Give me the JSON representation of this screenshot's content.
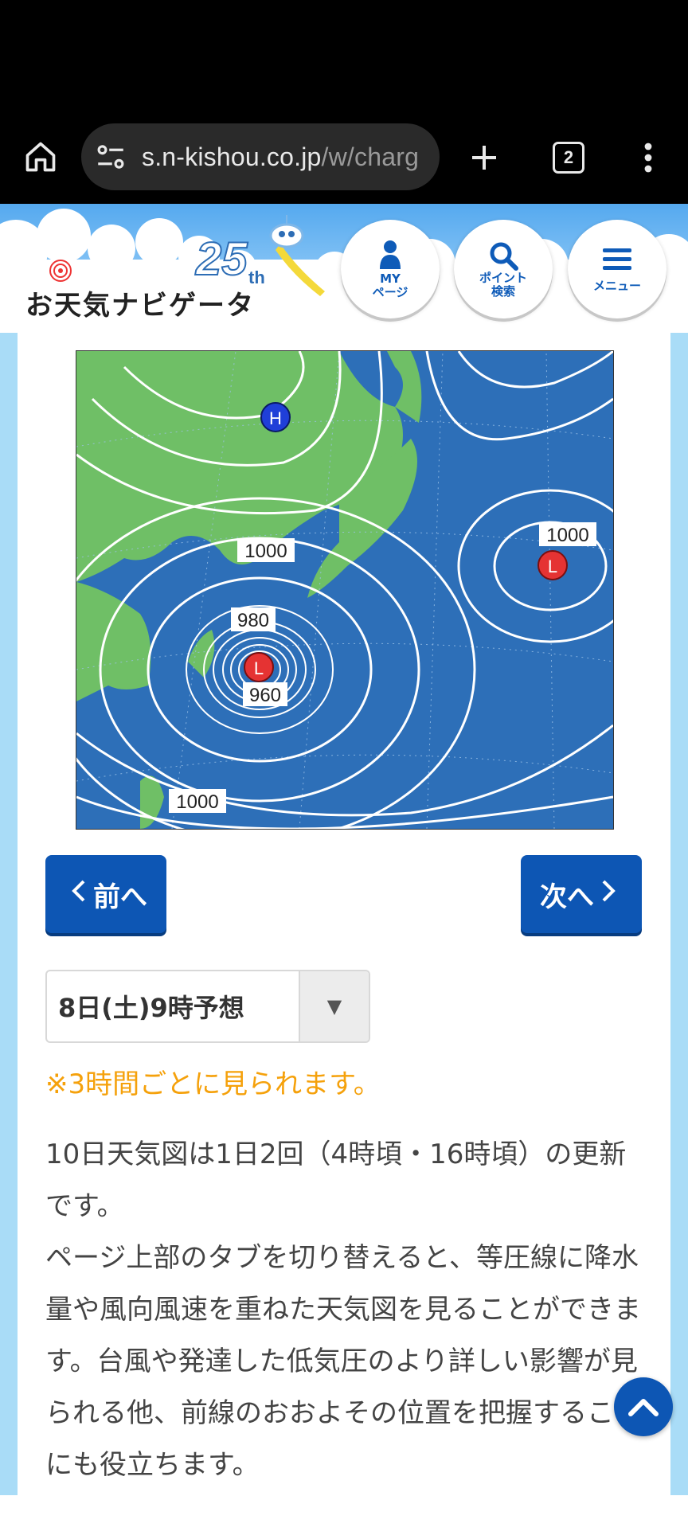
{
  "browser": {
    "url_host": "s.n-kishou.co.jp",
    "url_path": "/w/charg",
    "tab_count": "2"
  },
  "header": {
    "logo_text": "お天気ナビゲータ",
    "anniversary_num": "25",
    "anniversary_suffix": "th",
    "my_page_label_1": "MY",
    "my_page_label_2": "ページ",
    "point_search_label_1": "ポイント",
    "point_search_label_2": "検索",
    "menu_label": "メニュー"
  },
  "map": {
    "high_label": "H",
    "low_labels": [
      "L",
      "L"
    ],
    "isobar_labels": [
      "1000",
      "1000",
      "980",
      "960",
      "1000"
    ]
  },
  "nav": {
    "prev_label": "前へ",
    "next_label": "次へ"
  },
  "selector": {
    "selected": "8日(土)9時予想"
  },
  "note": "※3時間ごとに見られます。",
  "description": "10日天気図は1日2回（4時頃・16時頃）の更新です。\nページ上部のタブを切り替えると、等圧線に降水量や風向風速を重ねた天気図を見ることができます。台風や発達した低気圧のより詳しい影響が見られる他、前線のおおよその位置を把握することにも役立ちます。",
  "colors": {
    "accent": "#0d56b4",
    "note": "#f5a10b",
    "sea": "#2d6fb8",
    "land": "#6fbf66",
    "side": "#a9dcf7"
  }
}
